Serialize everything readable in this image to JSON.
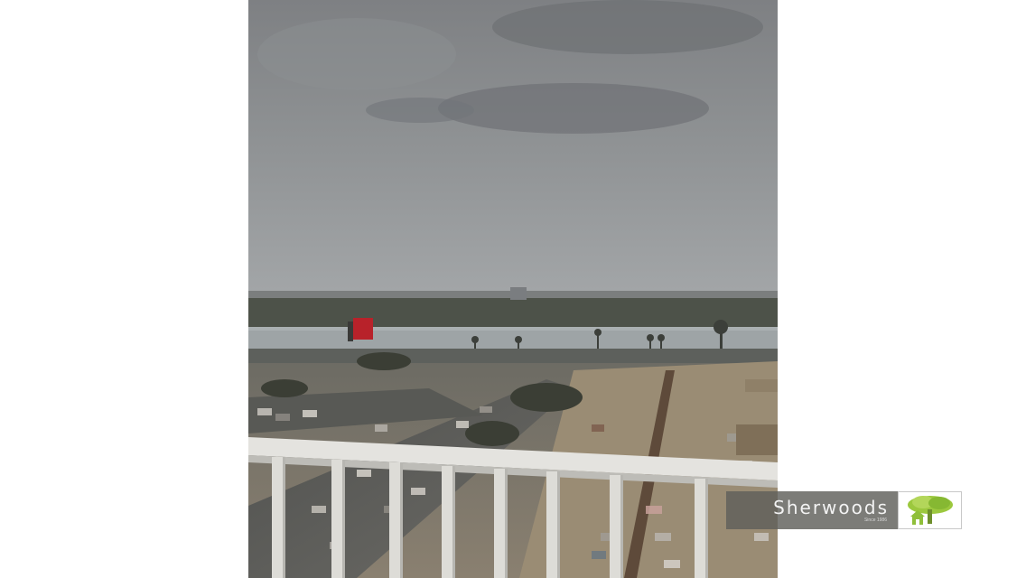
{
  "scene": {
    "description_kind": "photo",
    "watermark": {
      "brand": "Sherwoods",
      "tagline": "Since 1986",
      "logo_icon": "tree-house-logo-icon",
      "logo_color": "#8fbf3a",
      "banner_color": "#5f5f5a"
    }
  }
}
